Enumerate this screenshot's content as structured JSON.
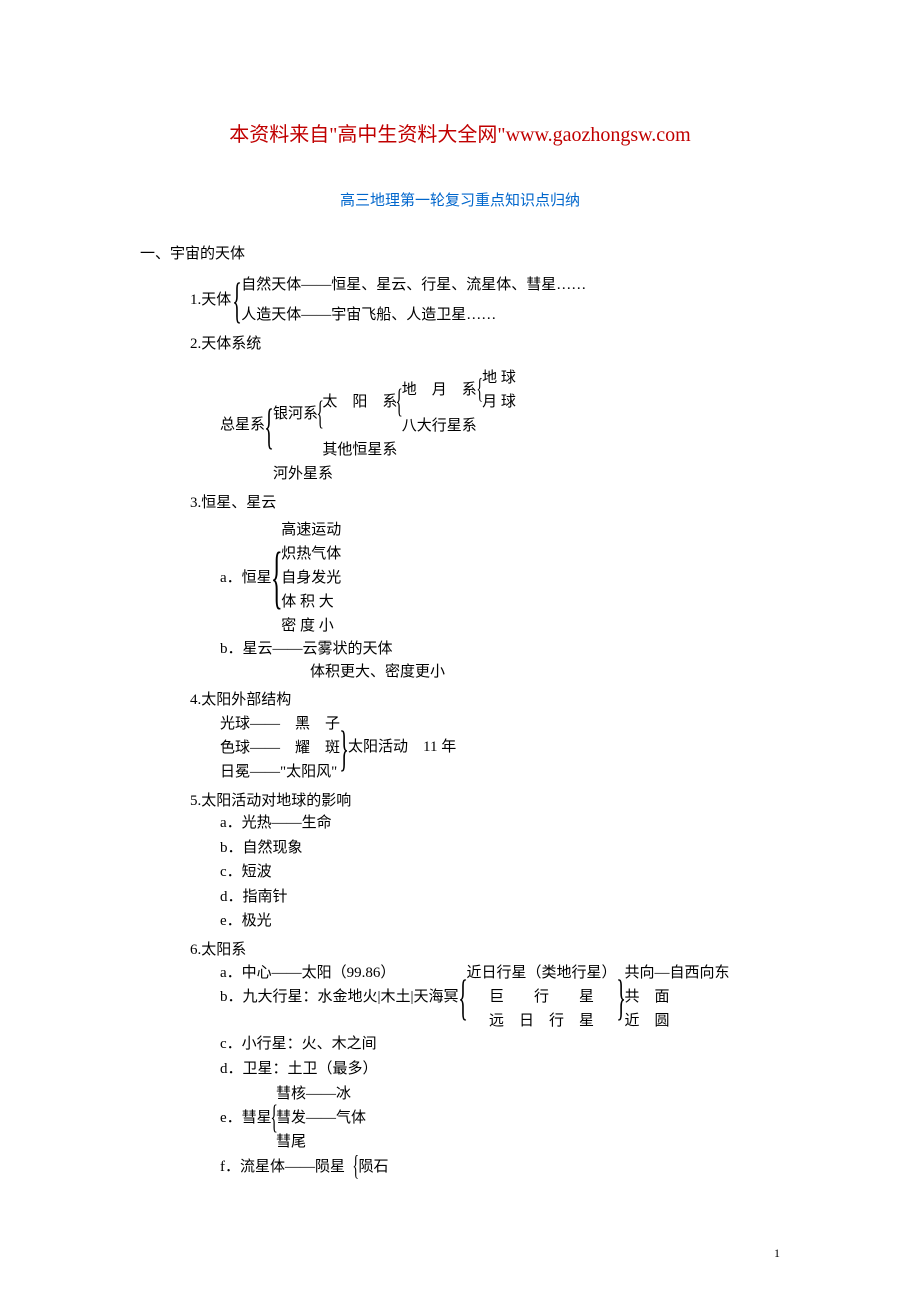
{
  "header": {
    "prefix": "本资料来自\"高中生资料大全网\"",
    "url": "www.gaozhongsw.com"
  },
  "subtitle": "高三地理第一轮复习重点知识点归纳",
  "section1": {
    "title": "一、宇宙的天体",
    "item1": {
      "label": "1.天体",
      "natural": "自然天体——恒星、星云、行星、流星体、彗星……",
      "artificial": "人造天体——宇宙飞船、人造卫星……"
    },
    "item2": {
      "label": "2.天体系统",
      "zongxingxi": "总星系",
      "yinhexi": "银河系",
      "hewaixingxi": "河外星系",
      "taiyangxi": "太　阳　系",
      "qitahengxing": "其他恒星系",
      "diyuexi": "地　月　系",
      "badaxingxi": "八大行星系",
      "diqiu": "地 球",
      "yueqiu": "月 球"
    },
    "item3": {
      "label": "3.恒星、星云",
      "a_label": "a．恒星",
      "a1": "高速运动",
      "a2": "炽热气体",
      "a3": "自身发光",
      "a4": "体 积 大",
      "a5": "密 度 小",
      "b": "b．星云——云雾状的天体",
      "b_sub": "体积更大、密度更小"
    },
    "item4": {
      "label": "4.太阳外部结构",
      "line1": "光球——　黑　子",
      "line2": "色球——　耀　斑",
      "line3": "日冕——\"太阳风\"",
      "right": "太阳活动　11 年"
    },
    "item5": {
      "label": "5.太阳活动对地球的影响",
      "a": "a．光热——生命",
      "b": "b．自然现象",
      "c": "c．短波",
      "d": "d．指南针",
      "e": "e．极光"
    },
    "item6": {
      "label": "6.太阳系",
      "a": "a．中心——太阳（99.86）",
      "b": "b．九大行星：水金地火|木土|天海冥",
      "b_r1": "近日行星（类地行星）",
      "b_r2": "巨　　行　　星",
      "b_r3": "远　日　行　星",
      "b_rr1": "共向—自西向东",
      "b_rr2": "共　面",
      "b_rr3": "近　圆",
      "c": "c．小行星：火、木之间",
      "d": "d．卫星：土卫（最多）",
      "e_label": "e．彗星",
      "e1": "彗核——冰",
      "e2": "彗发——气体",
      "e3": "彗尾",
      "f": "f．流星体——陨星",
      "f1": "陨石"
    }
  },
  "page_number": "1"
}
